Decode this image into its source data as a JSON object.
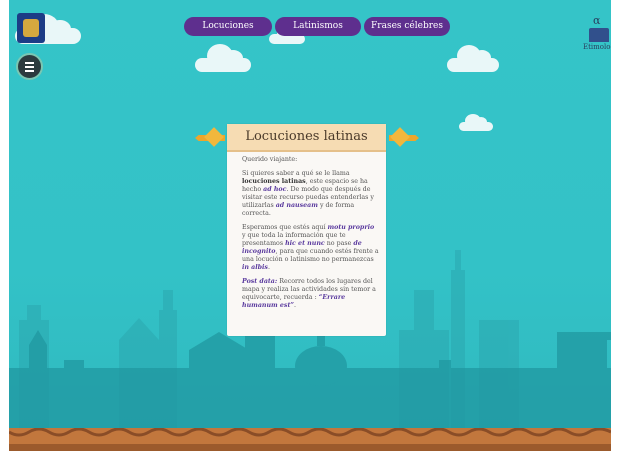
{
  "nav": {
    "locuciones": "Locuciones",
    "latinismos": "Latinismos",
    "frases": "Frases célebres"
  },
  "header": {
    "etimologia_label": "Etimología",
    "etimologia_symbol": "α"
  },
  "panel": {
    "title": "Locuciones latinas",
    "greeting": "Querido viajante:",
    "p1": {
      "a": "Si quieres saber a qué se le llama ",
      "b": "locuciones latinas",
      "c": ", este espacio se ha hecho ",
      "d": "ad hoc",
      "e": ". De modo que después de visitar este recurso puedas entenderlas y utilizarlas ",
      "f": "ad nauseam",
      "g": " y de forma correcta."
    },
    "p2": {
      "a": "Esperamos que estés aquí ",
      "b": "motu proprio",
      "c": " y que toda la información que te presentamos ",
      "d": "hic et nunc",
      "e": " no pase ",
      "f": "de incognito",
      "g": ", para que cuando estés frente a una locución o latinismo no permanezcas ",
      "h": "in albis",
      "i": "."
    },
    "p3": {
      "a": "Post data:",
      "b": " Recorre todos los lugares del mapa y realiza las actividades sin temor a equivocarte, recuerda : ",
      "c": "“Errare humanum est”",
      "d": "."
    }
  },
  "colors": {
    "sky": "#35c4c8",
    "nav_button": "#5e2f8e",
    "panel_title_bg": "#f6dcb3",
    "ribbon": "#eda62b",
    "emphasis": "#5a3a9e",
    "ground": "#c2773d"
  },
  "icons": [
    "unam-logo-icon",
    "menu-icon",
    "etimologia-icon"
  ]
}
